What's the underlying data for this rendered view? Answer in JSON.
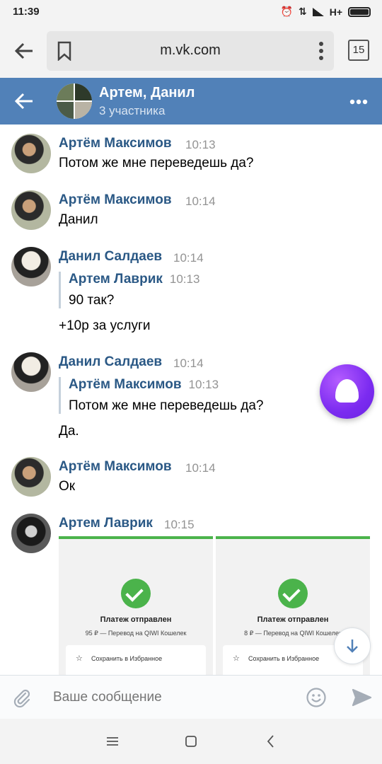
{
  "status_bar": {
    "time": "11:39",
    "network": "H+"
  },
  "browser": {
    "url": "m.vk.com",
    "tab_count": "15"
  },
  "chat_header": {
    "title": "Артем, Данил",
    "subtitle": "3 участника"
  },
  "messages": [
    {
      "author": "Артём Максимов",
      "time": "10:13",
      "text": "Потом же мне переведешь да?",
      "avatar": "artem-avatar"
    },
    {
      "author": "Артём Максимов",
      "time": "10:14",
      "text": "Данил",
      "avatar": "artem-avatar"
    },
    {
      "author": "Данил Салдаев",
      "time": "10:14",
      "quote": {
        "author": "Артем Лаврик",
        "time": "10:13",
        "text": "90 так?"
      },
      "text": "+10р за услуги",
      "avatar": "danil-avatar"
    },
    {
      "author": "Данил Салдаев",
      "time": "10:14",
      "quote": {
        "author": "Артём Максимов",
        "time": "10:13",
        "text": "Потом же мне переведешь да?"
      },
      "text": "Да.",
      "avatar": "danil-avatar"
    },
    {
      "author": "Артём Максимов",
      "time": "10:14",
      "text": "Ок",
      "avatar": "artem-avatar"
    },
    {
      "author": "Артем Лаврик",
      "time": "10:15",
      "avatar": "lavrik-avatar",
      "attachments": [
        {
          "title": "Платеж отправлен",
          "desc": "95 ₽ — Перевод на QIWI Кошелек",
          "action": "Сохранить в Избранное"
        },
        {
          "title": "Платеж отправлен",
          "desc": "8 ₽ — Перевод на QIWI Кошелек",
          "action": "Сохранить в Избранное"
        }
      ]
    }
  ],
  "compose": {
    "placeholder": "Ваше сообщение"
  },
  "colors": {
    "header": "#5181b8",
    "link": "#2a5885",
    "success": "#4bb34b",
    "assistant": "#7b2bf0"
  }
}
